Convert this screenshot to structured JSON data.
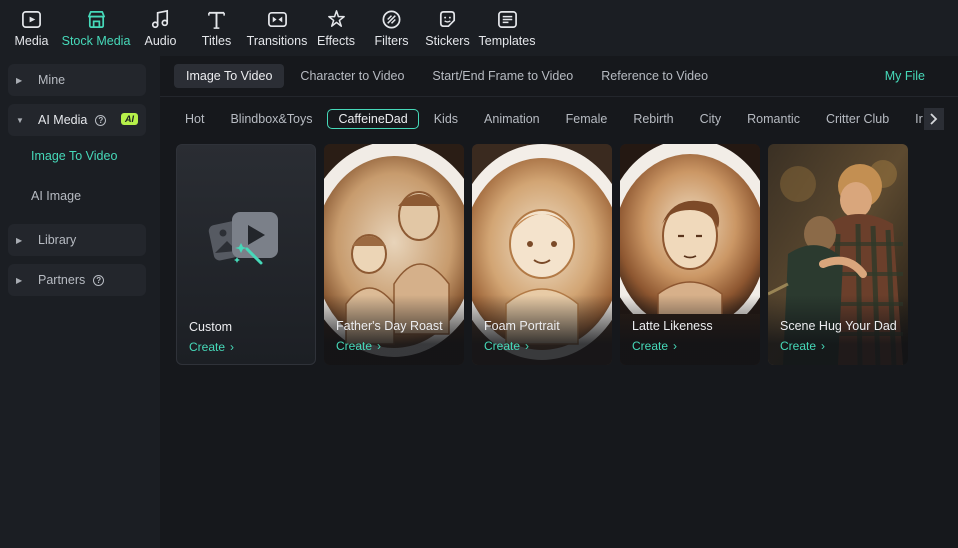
{
  "toolbar": {
    "items": [
      {
        "label": "Media",
        "icon": "media-icon"
      },
      {
        "label": "Stock Media",
        "icon": "stock-media-icon",
        "active": true
      },
      {
        "label": "Audio",
        "icon": "audio-icon"
      },
      {
        "label": "Titles",
        "icon": "titles-icon"
      },
      {
        "label": "Transitions",
        "icon": "transitions-icon"
      },
      {
        "label": "Effects",
        "icon": "effects-icon"
      },
      {
        "label": "Filters",
        "icon": "filters-icon"
      },
      {
        "label": "Stickers",
        "icon": "stickers-icon"
      },
      {
        "label": "Templates",
        "icon": "templates-icon"
      }
    ]
  },
  "sidebar": {
    "mine": "Mine",
    "ai_media": "AI Media",
    "ai_badge": "AI",
    "sub": {
      "image_to_video": "Image To Video",
      "ai_image": "AI Image"
    },
    "library": "Library",
    "partners": "Partners"
  },
  "mode_tabs": [
    "Image To Video",
    "Character to Video",
    "Start/End Frame to Video",
    "Reference to Video"
  ],
  "my_file": "My File",
  "categories": [
    "Hot",
    "Blindbox&Toys",
    "CaffeineDad",
    "Kids",
    "Animation",
    "Female",
    "Rebirth",
    "City",
    "Romantic",
    "Critter Club",
    "Ir"
  ],
  "active_category": "CaffeineDad",
  "cards": [
    {
      "title": "Custom",
      "action": "Create"
    },
    {
      "title": "Father's Day Roast",
      "action": "Create"
    },
    {
      "title": "Foam Portrait",
      "action": "Create"
    },
    {
      "title": "Latte Likeness",
      "action": "Create"
    },
    {
      "title": "Scene Hug Your Dad",
      "action": "Create"
    }
  ],
  "colors": {
    "accent": "#46d9b9",
    "ai_badge": "#b6f04a",
    "background": "#16181c",
    "panel": "#1b1e23"
  }
}
